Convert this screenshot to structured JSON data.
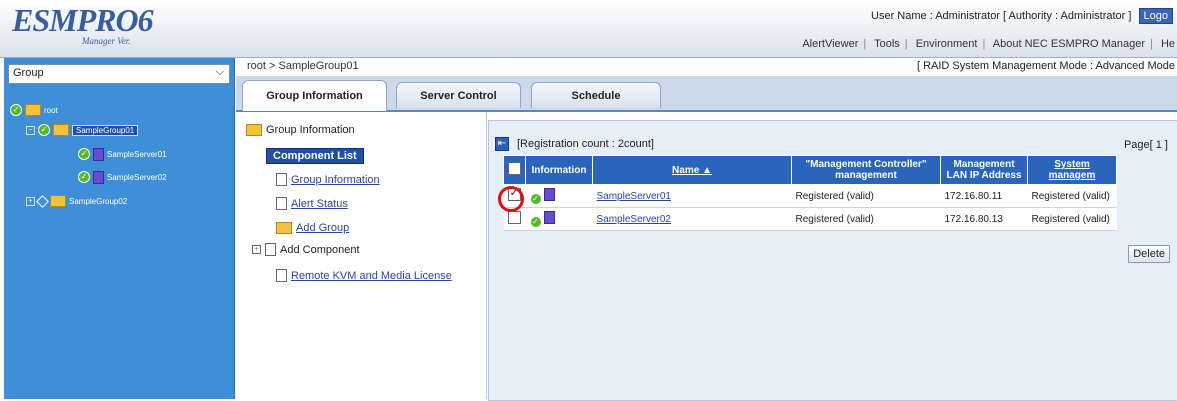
{
  "header": {
    "logo": "ESMPRO6",
    "logo_sub": "Manager Ver.",
    "user_line": "User Name : Administrator  [ Authority : Administrator ]",
    "logout": "Logo",
    "nav": [
      "AlertViewer",
      "Tools",
      "Environment",
      "About NEC ESMPRO Manager",
      "He"
    ]
  },
  "left": {
    "group_select": "Group",
    "tree": [
      {
        "label": "root"
      },
      {
        "label": "SampleGroup01"
      },
      {
        "label": "SampleServer01"
      },
      {
        "label": "SampleServer02"
      },
      {
        "label": "SampleGroup02"
      }
    ]
  },
  "breadcrumb": "root > SampleGroup01",
  "raid_mode": "[ RAID System Management Mode : Advanced Mode",
  "tabs": [
    {
      "label": "Group Information"
    },
    {
      "label": "Server Control"
    },
    {
      "label": "Schedule"
    }
  ],
  "menu": {
    "title": "Group Information",
    "items": [
      "Component List",
      "Group Information",
      "Alert Status",
      "Add Group",
      "Add Component",
      "Remote KVM and Media License"
    ]
  },
  "content": {
    "registration": "[Registration count : 2count]",
    "page": "Page[  1  ]",
    "columns": [
      "Information",
      "Name",
      "\"Management Controller\" management",
      "Management LAN IP Address",
      "System managem"
    ],
    "rows": [
      {
        "name": "SampleServer01",
        "mgmt": "Registered (valid)",
        "ip": "172.16.80.11",
        "sys": "Registered (valid)",
        "checked": true
      },
      {
        "name": "SampleServer02",
        "mgmt": "Registered (valid)",
        "ip": "172.16.80.13",
        "sys": "Registered (valid)",
        "checked": false
      }
    ],
    "delete": "Delete"
  },
  "colors": {
    "accent": "#3e8fd7",
    "header_blue": "#2a64bb",
    "highlight": "#e01010"
  }
}
